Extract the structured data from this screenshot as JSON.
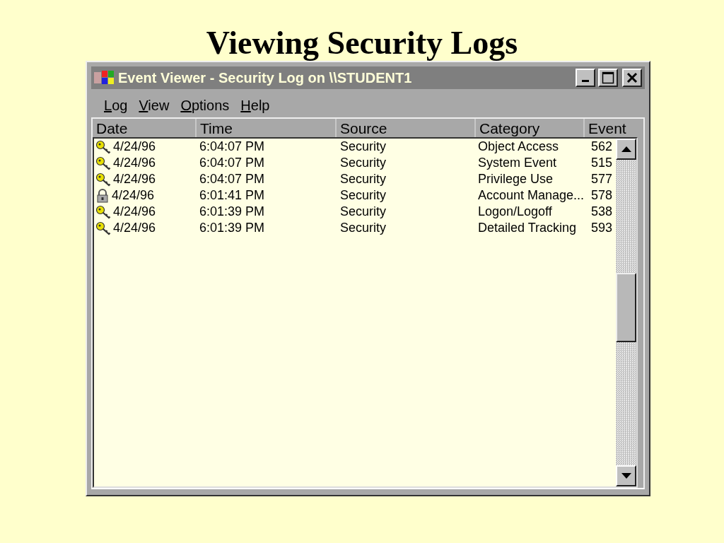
{
  "slide_title": "Viewing Security Logs",
  "window": {
    "title": "Event Viewer - Security Log on \\\\STUDENT1"
  },
  "menu": [
    "Log",
    "View",
    "Options",
    "Help"
  ],
  "table": {
    "columns": [
      "Date",
      "Time",
      "Source",
      "Category",
      "Event"
    ],
    "rows": [
      {
        "kind": "key",
        "date": "4/24/96",
        "time": "6:04:07 PM",
        "source": "Security",
        "category": "Object Access",
        "event": "562"
      },
      {
        "kind": "key",
        "date": "4/24/96",
        "time": "6:04:07 PM",
        "source": "Security",
        "category": "System Event",
        "event": "515"
      },
      {
        "kind": "key",
        "date": "4/24/96",
        "time": "6:04:07 PM",
        "source": "Security",
        "category": "Privilege Use",
        "event": "577"
      },
      {
        "kind": "lock",
        "date": "4/24/96",
        "time": "6:01:41 PM",
        "source": "Security",
        "category": "Account Manage...",
        "event": "578"
      },
      {
        "kind": "key",
        "date": "4/24/96",
        "time": "6:01:39 PM",
        "source": "Security",
        "category": "Logon/Logoff",
        "event": "538"
      },
      {
        "kind": "key",
        "date": "4/24/96",
        "time": "6:01:39 PM",
        "source": "Security",
        "category": "Detailed Tracking",
        "event": "593"
      }
    ]
  }
}
